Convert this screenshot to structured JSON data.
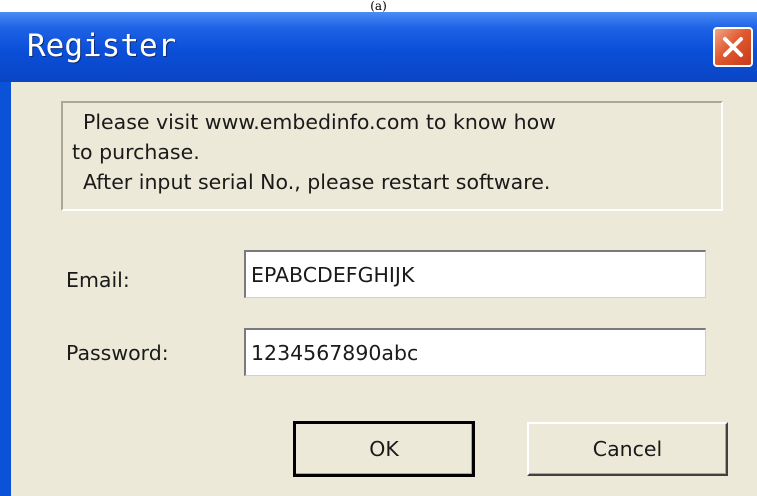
{
  "caption": "(a)",
  "window": {
    "title": "Register",
    "close_icon": "close-icon"
  },
  "info": {
    "line1": "Please visit www.embedinfo.com to know how",
    "line2": "to purchase.",
    "line3": "After input serial No., please restart software."
  },
  "form": {
    "email_label": "Email:",
    "email_value": "EPABCDEFGHIJK",
    "password_label": "Password:",
    "password_value": "1234567890abc"
  },
  "buttons": {
    "ok_label": "OK",
    "cancel_label": "Cancel"
  },
  "colors": {
    "titlebar": "#0a4fd8",
    "client_background": "#ece9d8",
    "close_button": "#e05a2f"
  }
}
